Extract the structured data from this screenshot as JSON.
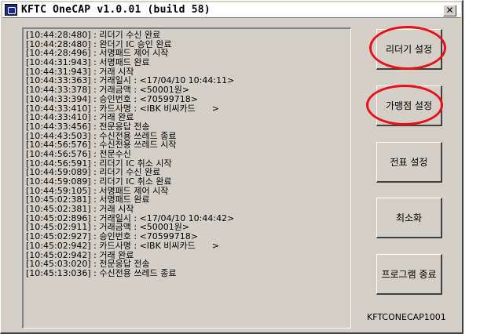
{
  "window": {
    "title": "KFTC OneCAP v1.0.01 (build 58)",
    "close_glyph": "✕"
  },
  "log": [
    "[10:44:28:480] : 리더기 수신 완료",
    "[10:44:28:480] : 완더기 IC 승인 완료",
    "[10:44:28:496] : 서명패드 제어 시작",
    "[10:44:31:943] : 서명패드 완료",
    "[10:44:31:943] : 거래 시작",
    "[10:44:33:363] : 거래일시 : <17/04/10 10:44:11>",
    "[10:44:33:378] : 거래금액 : <50001원>",
    "[10:44:33:394] : 승인번호 : <70599718>",
    "[10:44:33:410] : 카드사명 : <IBK 비씨카드      >",
    "[10:44:33:410] : 거래 완료",
    "[10:44:33:456] : 전문응답 전송",
    "[10:44:43:503] : 수신전용 쓰레드 종료",
    "[10:44:56:576] : 수신전용 쓰레드 시작",
    "[10:44:56:576] : 전문수신",
    "[10:44:56:591] : 리더기 IC 취소 시작",
    "[10:44:59:089] : 리더기 수신 완료",
    "[10:44:59:089] : 리더기 IC 취소 완료",
    "[10:44:59:105] : 서명패드 제어 시작",
    "[10:45:02:381] : 서명패드 완료",
    "[10:45:02:381] : 거래 시작",
    "[10:45:02:896] : 거래일시 : <17/04/10 10:44:42>",
    "[10:45:02:911] : 거래금액 : <50001원>",
    "[10:45:02:927] : 승인번호 : <70599718>",
    "[10:45:02:942] : 카드사명 : <IBK 비씨카드      >",
    "[10:45:02:942] : 거래 완료",
    "[10:45:03:020] : 전문응답 전송",
    "[10:45:13:036] : 수신전용 쓰레드 종료"
  ],
  "buttons": {
    "reader_settings": "리더기 설정",
    "merchant_settings": "가맹점 설정",
    "slip_settings": "전표 설정",
    "minimize": "최소화",
    "exit_program": "프로그램 종료"
  },
  "footer_code": "KFTCONECAP1001",
  "colors": {
    "highlight": "#e8101a",
    "window_face": "#d4d0c8"
  }
}
